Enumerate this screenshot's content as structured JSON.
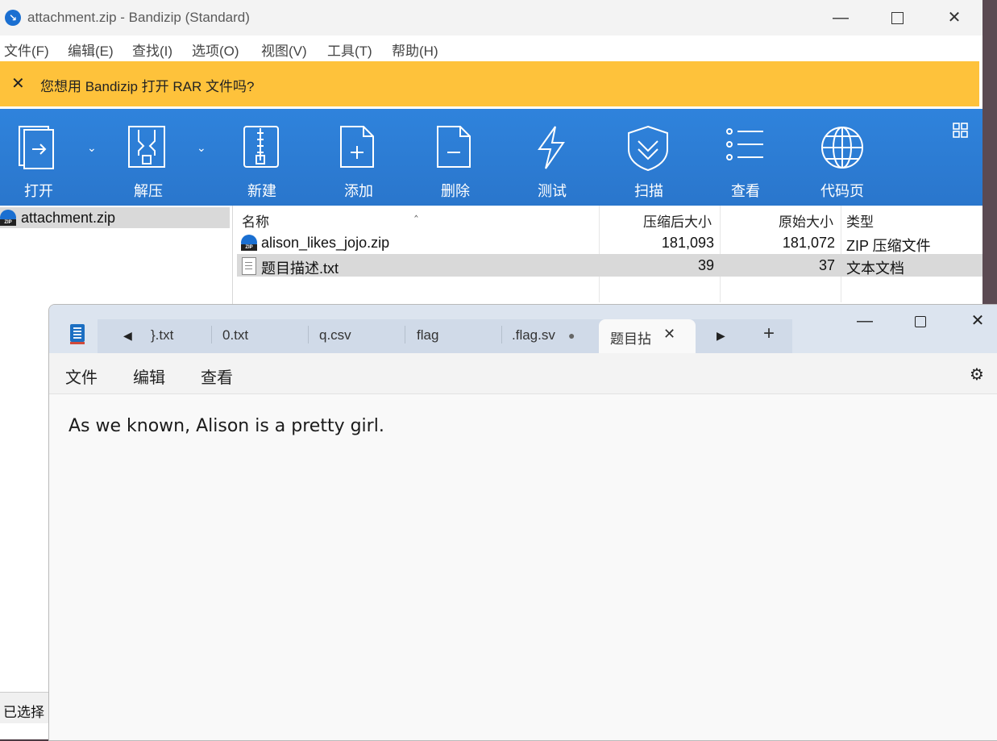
{
  "bandizip": {
    "title": "attachment.zip - Bandizip (Standard)",
    "menu": [
      "文件(F)",
      "编辑(E)",
      "查找(I)",
      "选项(O)",
      "视图(V)",
      "工具(T)",
      "帮助(H)"
    ],
    "notice": "您想用 Bandizip 打开 RAR 文件吗?",
    "toolbar": {
      "open": "打开",
      "extract": "解压",
      "new": "新建",
      "add": "添加",
      "delete": "删除",
      "test": "测试",
      "scan": "扫描",
      "view": "查看",
      "codepage": "代码页"
    },
    "tree": {
      "root": "attachment.zip"
    },
    "list": {
      "headers": {
        "name": "名称",
        "packed": "压缩后大小",
        "size": "原始大小",
        "type": "类型"
      },
      "rows": [
        {
          "name": "alison_likes_jojo.zip",
          "packed": "181,093",
          "size": "181,072",
          "type": "ZIP 压缩文件"
        },
        {
          "name": "题目描述.txt",
          "packed": "39",
          "size": "37",
          "type": "文本文档"
        }
      ]
    },
    "status": "已选择"
  },
  "notepad": {
    "tabs": [
      " .txt",
      "0.txt",
      "q.csv",
      "flag",
      ".flag.sv",
      "题目拈"
    ],
    "tab_first": "}.txt",
    "menu": {
      "file": "文件",
      "edit": "编辑",
      "view": "查看"
    },
    "content": "As we known, Alison is a pretty girl."
  },
  "colors": {
    "toolbar": "#2f7fd6",
    "notice": "#fec23b",
    "tab_bar": "#dce4ef"
  }
}
